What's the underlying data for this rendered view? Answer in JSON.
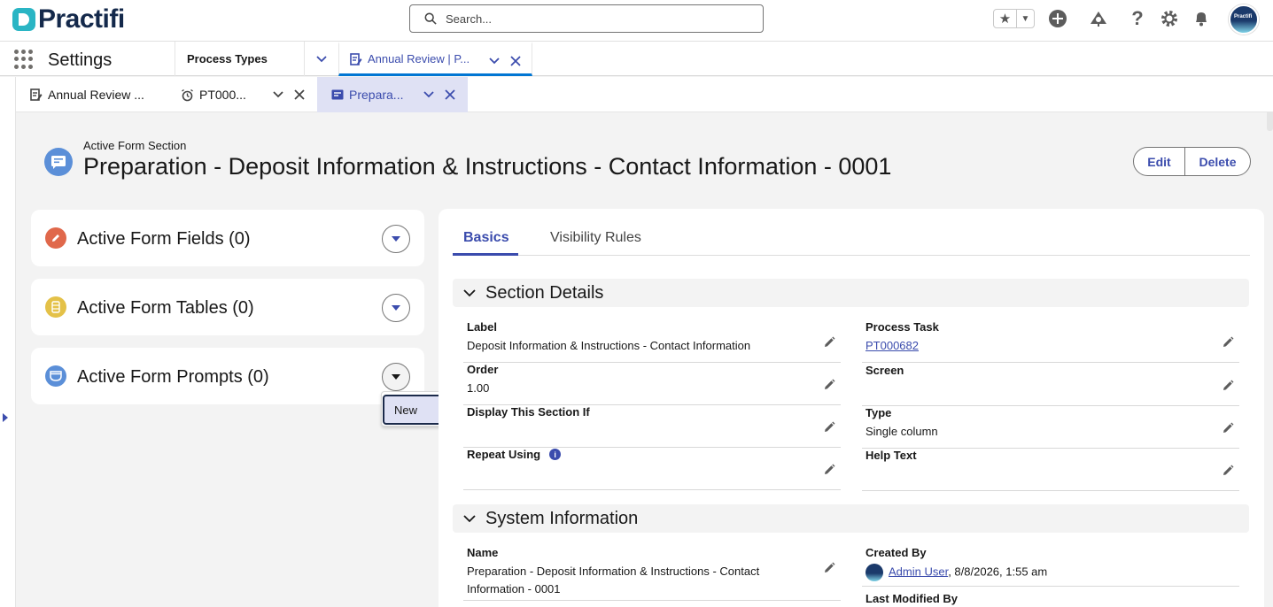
{
  "header": {
    "brand": "Practifi",
    "search_placeholder": "Search...",
    "avatar_text": "Practifi",
    "icons": [
      "star-icon",
      "add-icon",
      "setup-assistant-icon",
      "help-icon",
      "gear-icon",
      "bell-icon"
    ]
  },
  "nav": {
    "app_name": "Settings",
    "tabs": [
      {
        "label": "Process Types"
      },
      {
        "label": "Annual Review | P..."
      }
    ]
  },
  "subtabs": [
    {
      "label": "Annual Review ..."
    },
    {
      "label": "PT000..."
    },
    {
      "label": "Prepara..."
    }
  ],
  "record": {
    "type": "Active Form Section",
    "title": "Preparation - Deposit Information & Instructions - Contact Information - 0001",
    "actions": {
      "edit": "Edit",
      "delete": "Delete"
    }
  },
  "related": [
    {
      "title": "Active Form Fields (0)",
      "color": "#e0684b"
    },
    {
      "title": "Active Form Tables (0)",
      "color": "#e4c148"
    },
    {
      "title": "Active Form Prompts (0)",
      "color": "#5b8fd8"
    }
  ],
  "menu": {
    "new": "New"
  },
  "detail": {
    "tabs": [
      "Basics",
      "Visibility Rules"
    ],
    "sections": [
      {
        "title": "Section Details"
      },
      {
        "title": "System Information"
      }
    ],
    "fields": {
      "label": {
        "label": "Label",
        "value": "Deposit Information & Instructions - Contact Information"
      },
      "process_task": {
        "label": "Process Task",
        "value": "PT000682"
      },
      "order": {
        "label": "Order",
        "value": "1.00"
      },
      "screen": {
        "label": "Screen",
        "value": ""
      },
      "display_if": {
        "label": "Display This Section If",
        "value": ""
      },
      "type": {
        "label": "Type",
        "value": "Single column"
      },
      "repeat_using": {
        "label": "Repeat Using",
        "value": ""
      },
      "help_text": {
        "label": "Help Text",
        "value": ""
      },
      "name": {
        "label": "Name",
        "value_line1": "Preparation - Deposit Information & Instructions - Contact",
        "value_line2": "Information - 0001"
      },
      "created_by": {
        "label": "Created By",
        "user": "Admin User",
        "date": ", 8/8/2026, 1:55 am"
      },
      "last_modified": {
        "label": "Last Modified By"
      }
    }
  },
  "colors": {
    "accent": "#3b4cad",
    "brand": "#2ab5c4"
  }
}
